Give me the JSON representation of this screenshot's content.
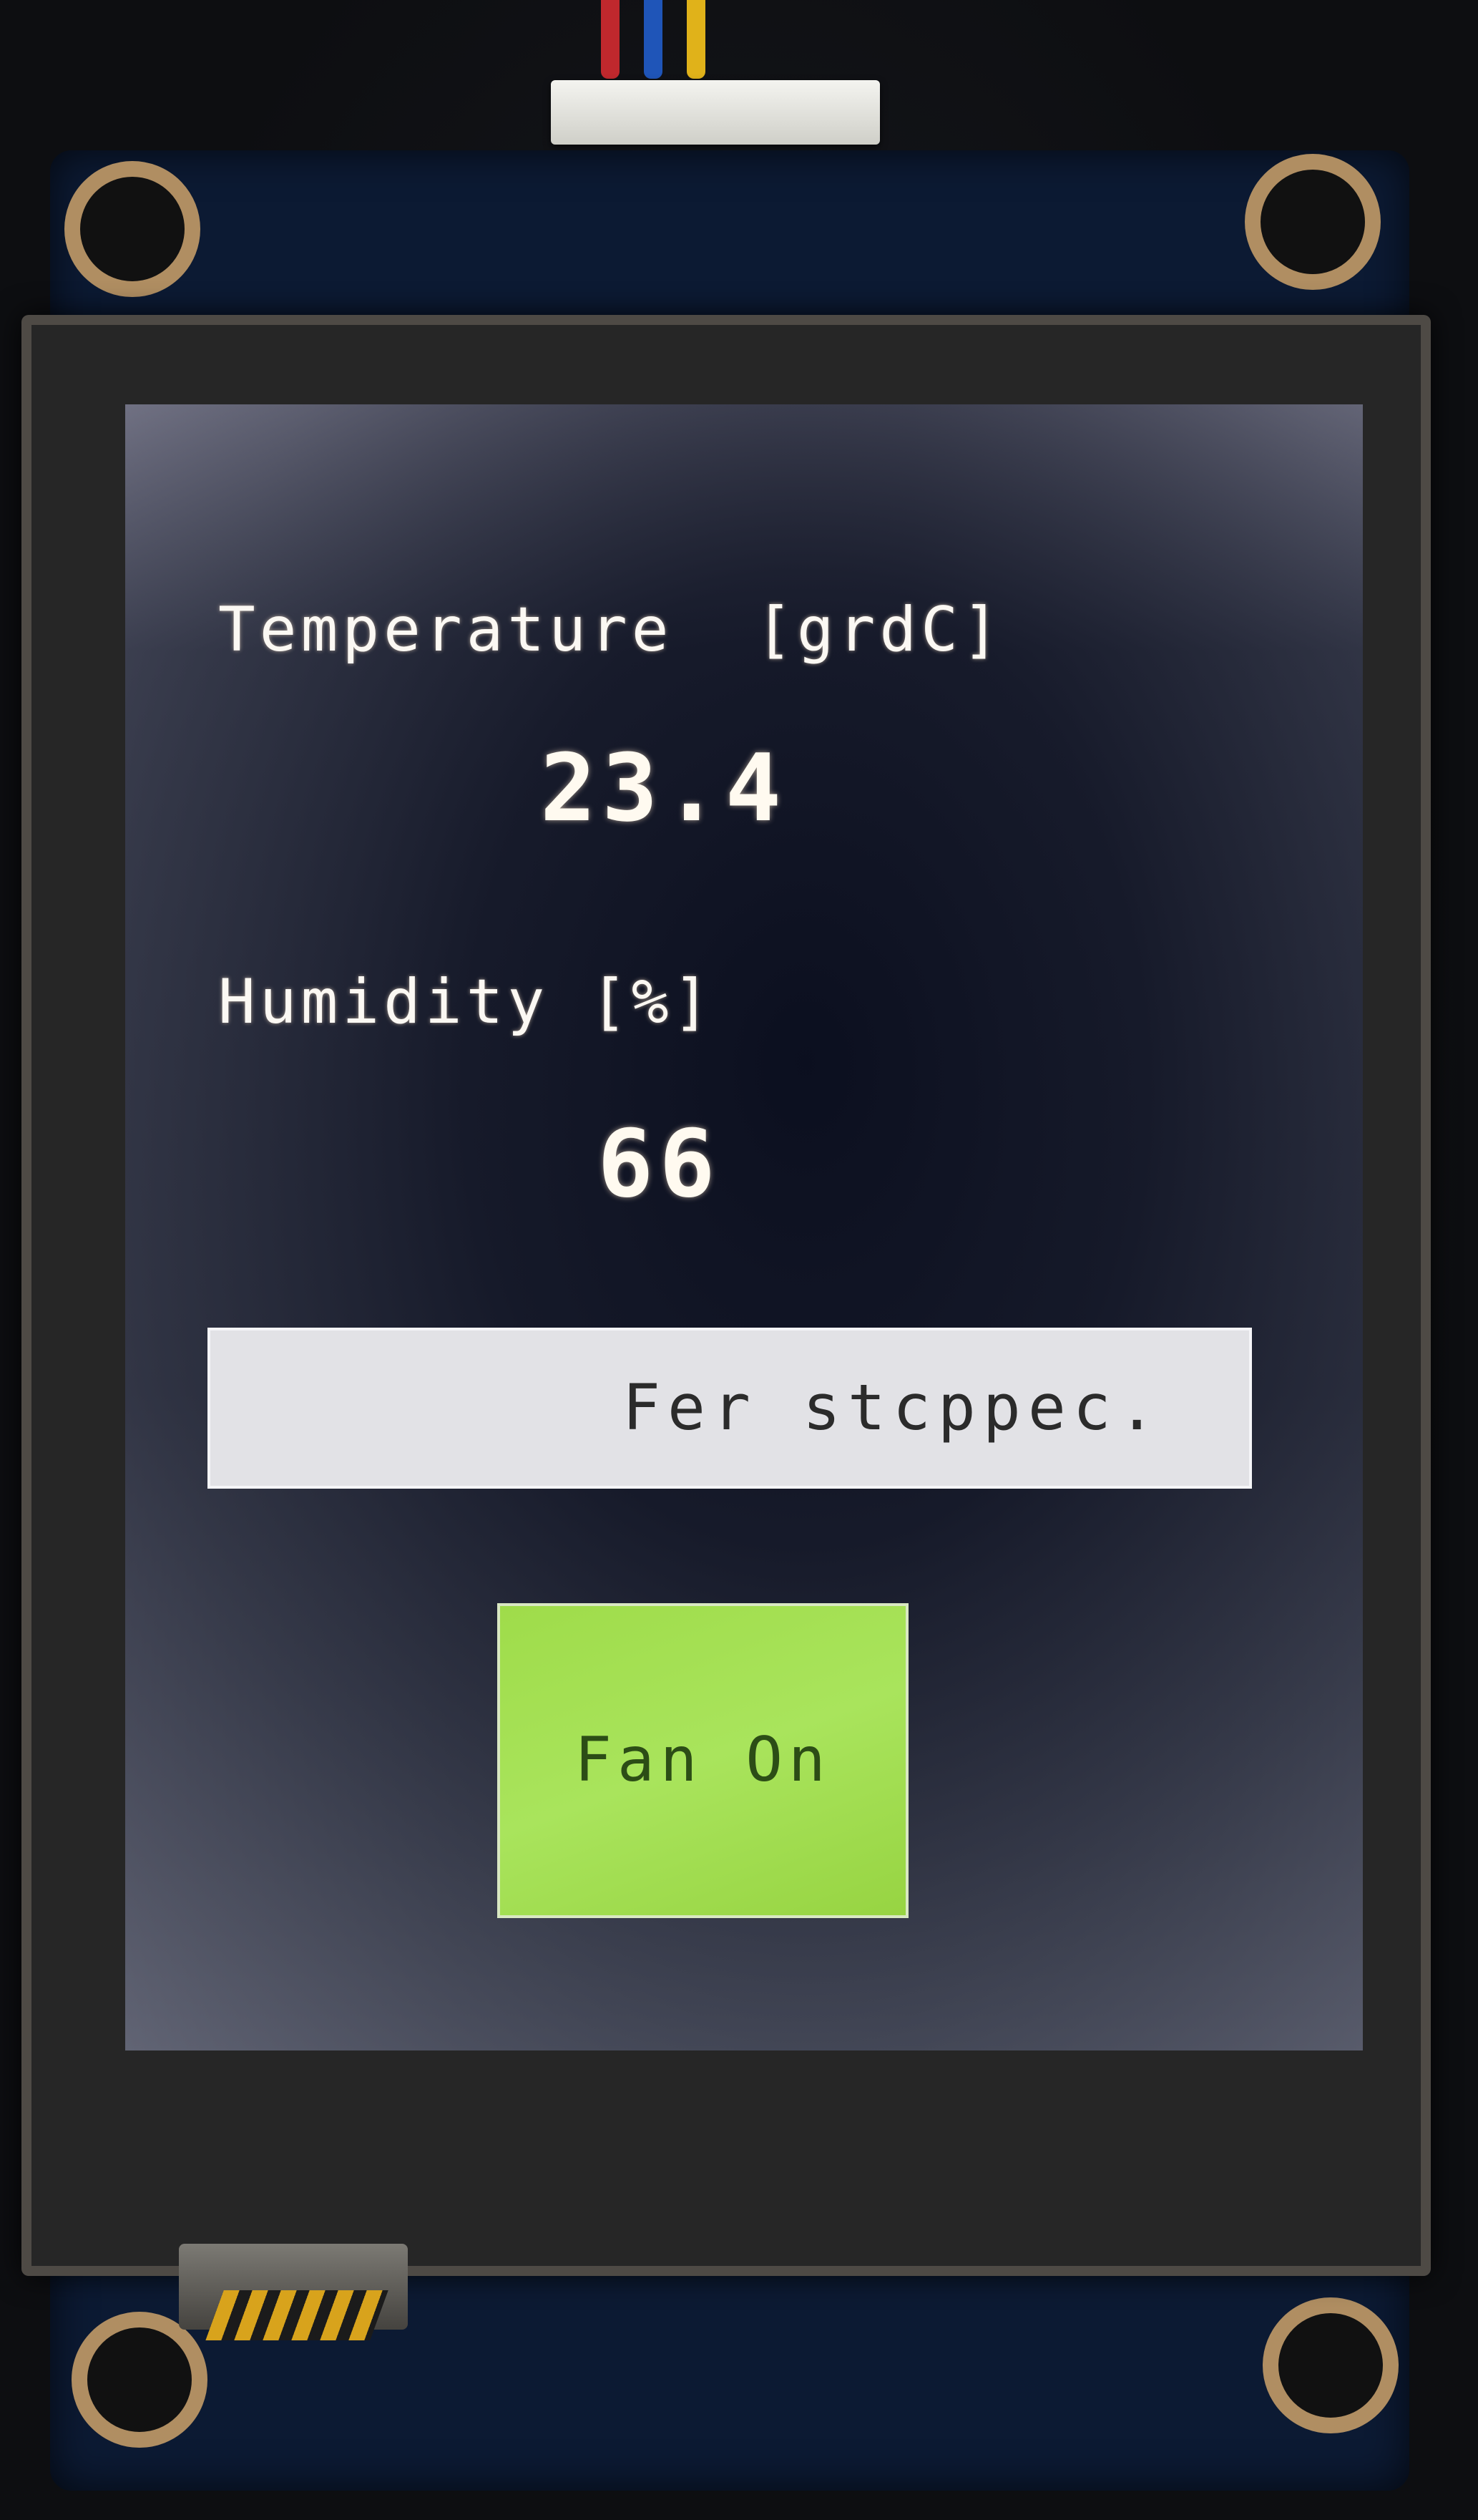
{
  "screen": {
    "temperature": {
      "label": "Temperature  [grdC]",
      "value": "23.4"
    },
    "humidity": {
      "label": "Humidity [%]",
      "value": "66"
    },
    "status": {
      "text": "Fer stcppec."
    },
    "fan_button": {
      "label": "Fan On"
    }
  },
  "colors": {
    "screen_text": "#fbf8f3",
    "status_bar_bg": "#e2e2e6",
    "button_green": "#a9e45c",
    "button_text": "#2c4d16",
    "pcb": "#0c1a33"
  }
}
